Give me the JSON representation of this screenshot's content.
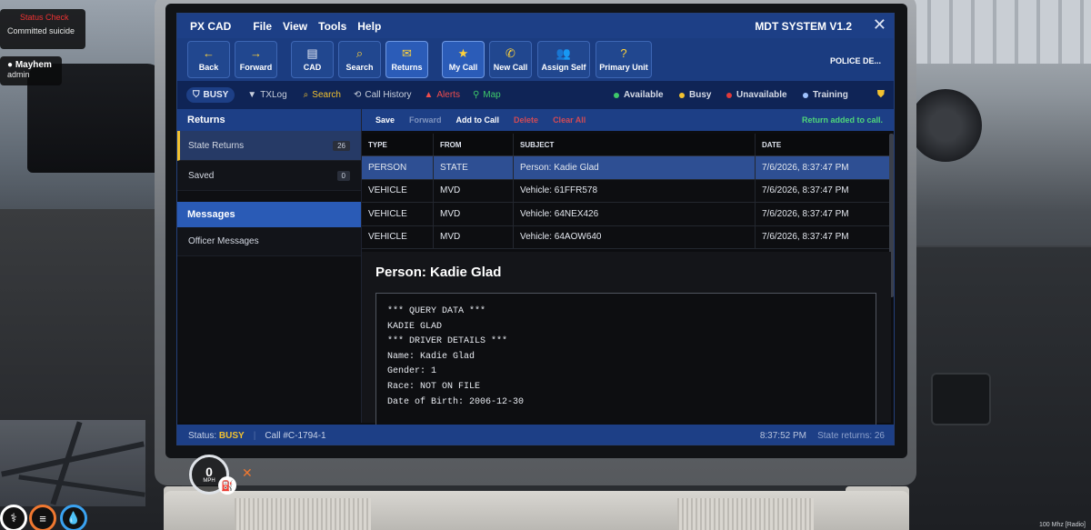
{
  "hud": {
    "status_check_title": "Status Check",
    "status_check_text": "Committed suicide",
    "username": "Mayhem",
    "role": "admin",
    "speed_value": "0",
    "speed_unit": "MPH",
    "corner_text": "100 Mhz [Radio]"
  },
  "window": {
    "menu": [
      "PX CAD",
      "File",
      "View",
      "Tools",
      "Help"
    ],
    "system_title": "MDT SYSTEM V1.2",
    "close_symbol": "✕"
  },
  "toolbar": {
    "buttons": [
      {
        "label": "Back",
        "icon": "←"
      },
      {
        "label": "Forward",
        "icon": "→"
      },
      {
        "label": "CAD",
        "icon": "▤"
      },
      {
        "label": "Search",
        "icon": "⌕"
      },
      {
        "label": "Returns",
        "icon": "✉"
      },
      {
        "label": "My Call",
        "icon": "★"
      },
      {
        "label": "New Call",
        "icon": "✆"
      },
      {
        "label": "Assign Self",
        "icon": "👥"
      },
      {
        "label": "Primary Unit",
        "icon": "?"
      }
    ],
    "department": "POLICE DE..."
  },
  "statusbar": {
    "busy_label": "BUSY",
    "items": [
      {
        "label": "TXLog",
        "icon": "▼"
      },
      {
        "label": "Search",
        "icon": "⌕"
      },
      {
        "label": "Call History",
        "icon": "⟲"
      },
      {
        "label": "Alerts",
        "icon": "▲"
      },
      {
        "label": "Map",
        "icon": "⚲"
      }
    ],
    "legend": [
      {
        "label": "Available",
        "color": "#3ec86a"
      },
      {
        "label": "Busy",
        "color": "#f2c230"
      },
      {
        "label": "Unavailable",
        "color": "#e03a3a"
      },
      {
        "label": "Training",
        "color": "#9fc3ff"
      }
    ]
  },
  "left": {
    "returns_header": "Returns",
    "returns_items": [
      {
        "label": "State Returns",
        "count": "26"
      },
      {
        "label": "Saved",
        "count": "0"
      }
    ],
    "messages_header": "Messages",
    "message_items": [
      "Officer Messages"
    ]
  },
  "actions": {
    "buttons": [
      "Save",
      "Forward",
      "Add to Call",
      "Delete",
      "Clear All"
    ],
    "message": "Return added to call."
  },
  "table": {
    "headers": [
      "TYPE",
      "FROM",
      "SUBJECT",
      "DATE"
    ],
    "rows": [
      [
        "PERSON",
        "STATE",
        "Person: Kadie Glad",
        "7/6/2026, 8:37:47 PM"
      ],
      [
        "VEHICLE",
        "MVD",
        "Vehicle: 61FFR578",
        "7/6/2026, 8:37:47 PM"
      ],
      [
        "VEHICLE",
        "MVD",
        "Vehicle: 64NEX426",
        "7/6/2026, 8:37:47 PM"
      ],
      [
        "VEHICLE",
        "MVD",
        "Vehicle: 64AOW640",
        "7/6/2026, 8:37:47 PM"
      ]
    ]
  },
  "detail": {
    "title": "Person: Kadie Glad",
    "lines": [
      "*** QUERY DATA ***",
      "KADIE GLAD",
      "",
      "*** DRIVER DETAILS ***",
      "Name: Kadie Glad",
      "Gender: 1",
      "Race: NOT ON FILE",
      "Date of Birth: 2006-12-30"
    ]
  },
  "footer": {
    "status_prefix": "Status:",
    "status_value": "BUSY",
    "separator": "|",
    "call": "Call #C-1794-1",
    "time": "8:37:52 PM",
    "returns": "State returns: 26"
  }
}
